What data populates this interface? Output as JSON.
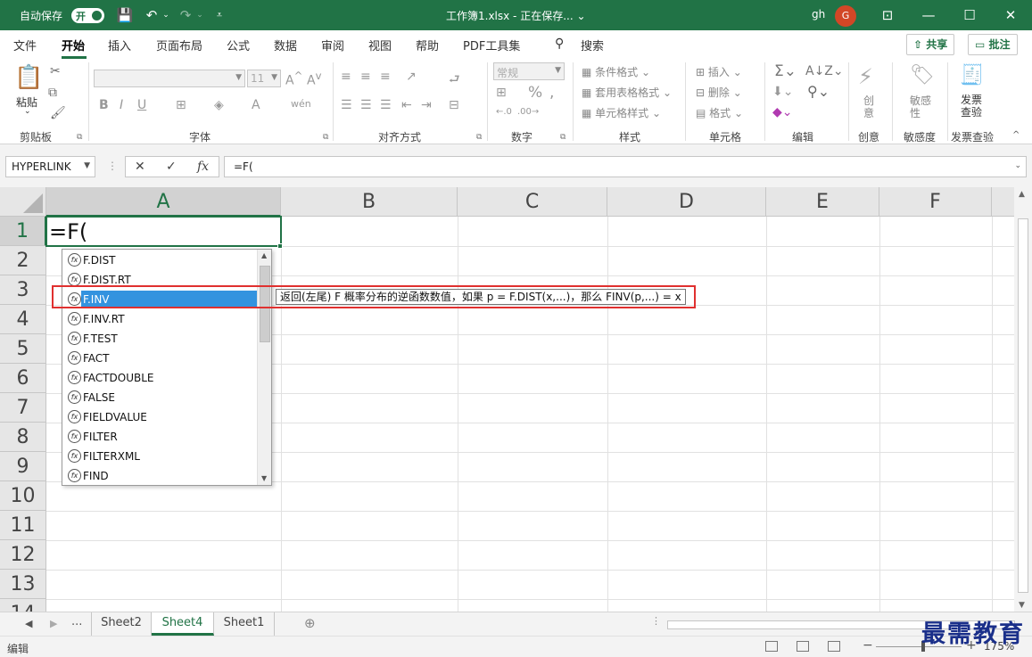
{
  "titlebar": {
    "autosave_label": "自动保存",
    "autosave_state": "开",
    "doc_title": "工作簿1.xlsx - 正在保存... ⌄",
    "user": "gh",
    "avatar_letter": "G"
  },
  "menu": {
    "tabs": [
      "文件",
      "开始",
      "插入",
      "页面布局",
      "公式",
      "数据",
      "审阅",
      "视图",
      "帮助",
      "PDF工具集"
    ],
    "search_label": "搜索",
    "share_label": "共享",
    "comments_label": "批注"
  },
  "ribbon": {
    "clipboard": {
      "paste": "粘贴",
      "label": "剪贴板"
    },
    "font": {
      "name": "",
      "size": "11",
      "label": "字体"
    },
    "alignment": {
      "label": "对齐方式"
    },
    "number": {
      "format": "常规",
      "label": "数字"
    },
    "styles": {
      "conditional": "条件格式",
      "table": "套用表格格式",
      "cell": "单元格样式",
      "label": "样式"
    },
    "cells": {
      "insert": "插入",
      "delete": "删除",
      "format": "格式",
      "label": "单元格"
    },
    "editing": {
      "label": "编辑"
    },
    "creativity": {
      "btn": "创意",
      "label": "创意"
    },
    "sensitivity": {
      "btn": "敏感性",
      "label": "敏感度"
    },
    "invoice": {
      "btn": "发票查验",
      "label": "发票查验"
    }
  },
  "formula_bar": {
    "name_box": "HYPERLINK",
    "cancel": "✕",
    "enter": "✓",
    "fx": "fx",
    "formula": "=F("
  },
  "grid": {
    "columns": [
      "A",
      "B",
      "C",
      "D",
      "E",
      "F"
    ],
    "rows": [
      "1",
      "2",
      "3",
      "4",
      "5",
      "6",
      "7",
      "8",
      "9",
      "10",
      "11",
      "12",
      "13",
      "14"
    ],
    "active_cell_value": "=F("
  },
  "autocomplete": {
    "items": [
      "F.DIST",
      "F.DIST.RT",
      "F.INV",
      "F.INV.RT",
      "F.TEST",
      "FACT",
      "FACTDOUBLE",
      "FALSE",
      "FIELDVALUE",
      "FILTER",
      "FILTERXML",
      "FIND"
    ],
    "selected": "F.INV",
    "tooltip": "返回(左尾) F 概率分布的逆函数数值，如果 p = F.DIST(x,...)，那么 FINV(p,...) = x"
  },
  "sheets": {
    "more": "...",
    "tabs": [
      "Sheet2",
      "Sheet4",
      "Sheet1"
    ],
    "active": "Sheet4"
  },
  "status": {
    "mode": "编辑",
    "zoom": "175%"
  },
  "watermark": "最需教育",
  "colors": {
    "excel_green": "#217346",
    "highlight_blue": "#3393df",
    "annotation_red": "#e0302f"
  }
}
